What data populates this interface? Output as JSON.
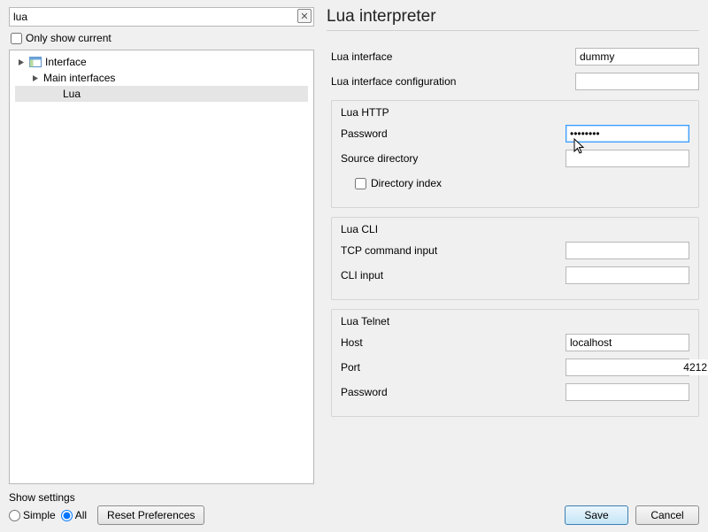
{
  "search": {
    "value": "lua"
  },
  "only_show_current": {
    "label": "Only show current",
    "checked": false
  },
  "tree": {
    "root": "Interface",
    "branch": "Main interfaces",
    "leaf": "Lua"
  },
  "show_settings": {
    "label": "Show settings",
    "simple": "Simple",
    "all": "All",
    "selected": "all"
  },
  "reset_button": "Reset Preferences",
  "page_title": "Lua interpreter",
  "fields": {
    "lua_interface": {
      "label": "Lua interface",
      "value": "dummy"
    },
    "lua_config": {
      "label": "Lua interface configuration",
      "value": ""
    }
  },
  "http": {
    "group": "Lua HTTP",
    "password": {
      "label": "Password",
      "value": "••••••••"
    },
    "srcdir": {
      "label": "Source directory",
      "value": ""
    },
    "dirindex": {
      "label": "Directory index",
      "checked": false
    }
  },
  "cli": {
    "group": "Lua CLI",
    "tcp": {
      "label": "TCP command input",
      "value": ""
    },
    "cli": {
      "label": "CLI input",
      "value": ""
    }
  },
  "telnet": {
    "group": "Lua Telnet",
    "host": {
      "label": "Host",
      "value": "localhost"
    },
    "port": {
      "label": "Port",
      "value": "4212"
    },
    "password": {
      "label": "Password",
      "value": ""
    }
  },
  "buttons": {
    "save": "Save",
    "cancel": "Cancel"
  }
}
